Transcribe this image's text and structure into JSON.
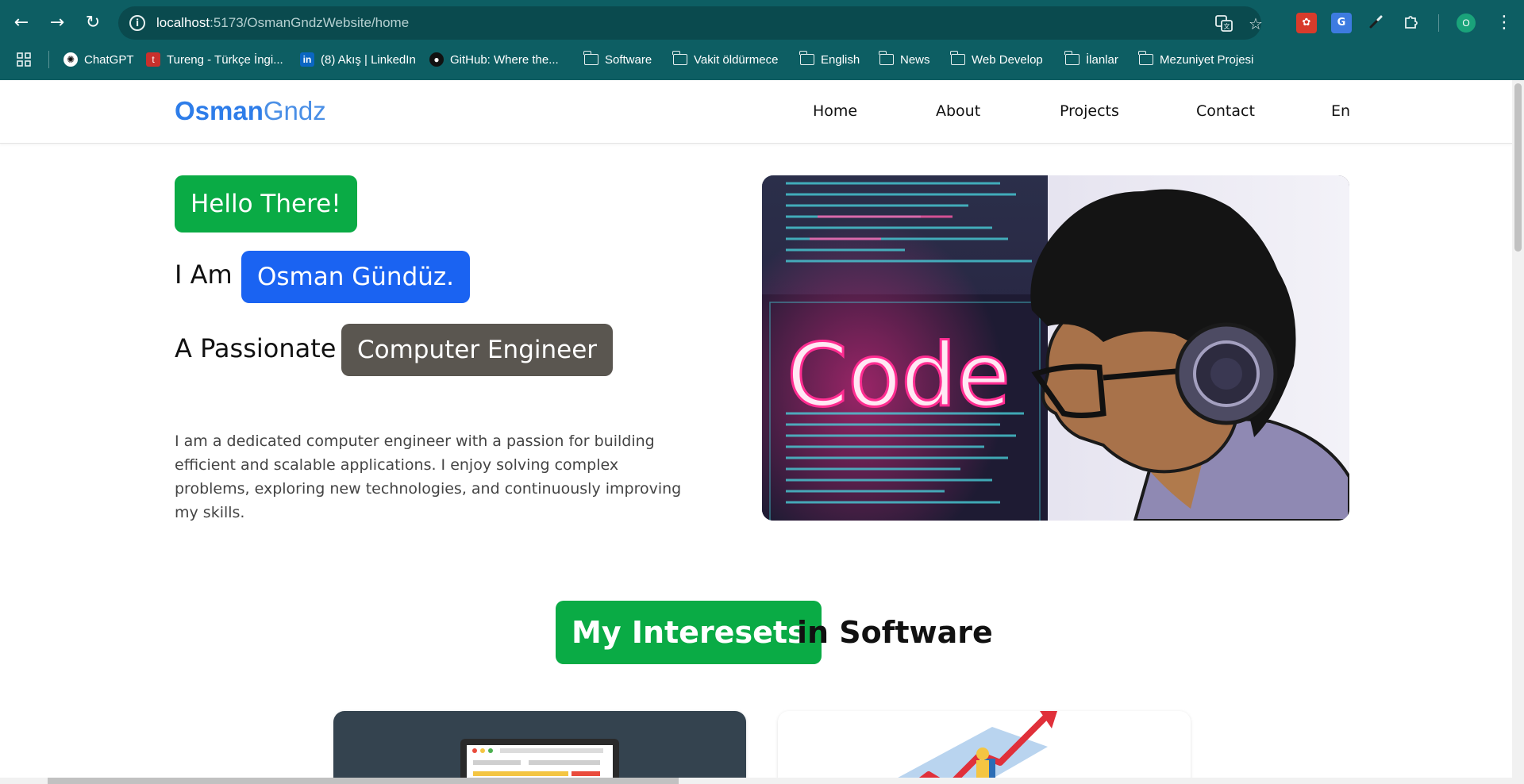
{
  "browser": {
    "url_host": "localhost",
    "url_path": ":5173/OsmanGndzWebsite/home",
    "profile_initial": "O",
    "bookmarks": [
      {
        "label": "ChatGPT"
      },
      {
        "label": "Tureng - Türkçe İngi..."
      },
      {
        "label": "(8) Akış | LinkedIn"
      },
      {
        "label": "GitHub: Where the..."
      },
      {
        "label": "Software"
      },
      {
        "label": "Vakit öldürmece"
      },
      {
        "label": "English"
      },
      {
        "label": "News"
      },
      {
        "label": "Web Develop"
      },
      {
        "label": "İlanlar"
      },
      {
        "label": "Mezuniyet Projesi"
      }
    ]
  },
  "site": {
    "logo_part1": "Osman",
    "logo_part2": "Gndz",
    "nav": [
      "Home",
      "About",
      "Projects",
      "Contact",
      "En"
    ]
  },
  "hero": {
    "greeting": "Hello There!",
    "i_am": "I Am",
    "name": "Osman Gündüz.",
    "a_passionate": "A Passionate",
    "role": "Computer Engineer",
    "description": "I am a dedicated computer engineer with a passion for building efficient and scalable applications. I enjoy solving complex problems, exploring new technologies, and continuously improving my skills.",
    "image_text": "Code"
  },
  "interests": {
    "highlight": "My Interesets",
    "rest": "in Software"
  },
  "colors": {
    "chrome": "#0d5e63",
    "green": "#0aab45",
    "blue": "#1a63f2",
    "gray": "#5a5650"
  }
}
